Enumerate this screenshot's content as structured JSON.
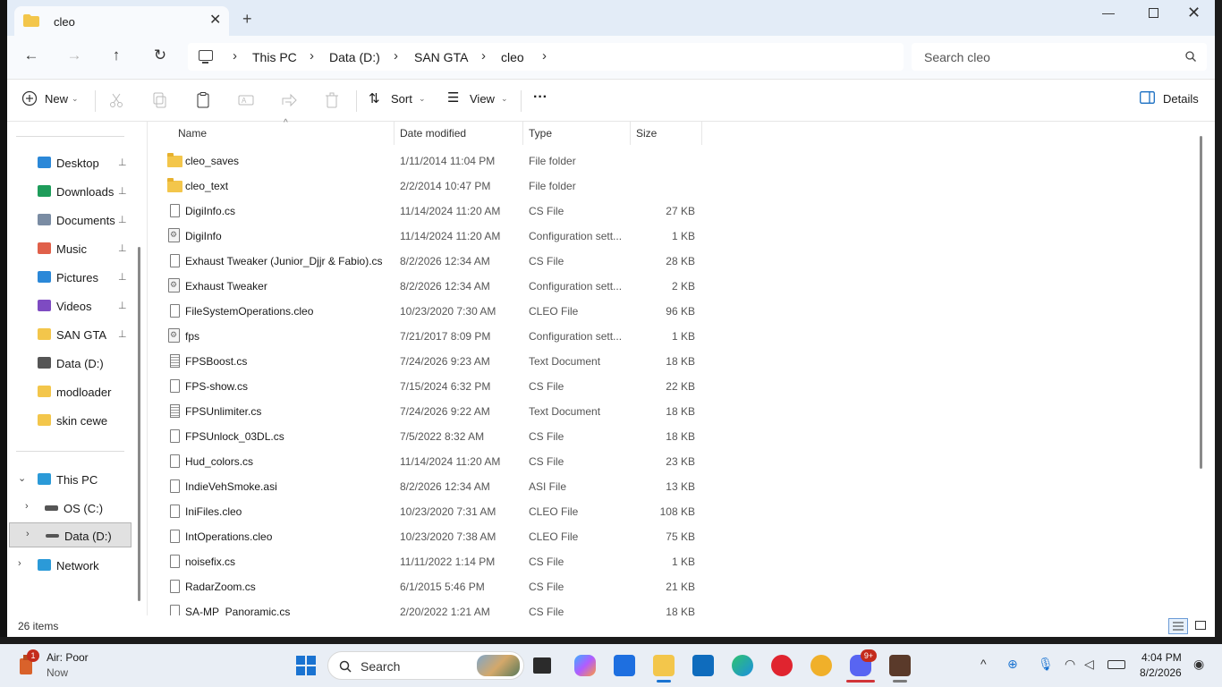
{
  "window": {
    "tab_title": "cleo",
    "new_tab": "+",
    "minimize": "—",
    "close": "✕"
  },
  "nav": {
    "back": "←",
    "forward": "→",
    "up": "↑",
    "refresh": "↻",
    "breadcrumb": [
      "This PC",
      "Data (D:)",
      "SAN GTA",
      "cleo"
    ],
    "separator": "›",
    "search_placeholder": "Search cleo"
  },
  "toolbar": {
    "new_label": "New",
    "sort_label": "Sort",
    "view_label": "View",
    "more_label": "···",
    "details_label": "Details"
  },
  "sidebar": {
    "quick_access": [
      {
        "label": "Desktop",
        "icon": "desktop-icon",
        "color": "#2b88d8"
      },
      {
        "label": "Downloads",
        "icon": "downloads-icon",
        "color": "#1e9c5a"
      },
      {
        "label": "Documents",
        "icon": "documents-icon",
        "color": "#7a8ca3"
      },
      {
        "label": "Music",
        "icon": "music-icon",
        "color": "#e0604a"
      },
      {
        "label": "Pictures",
        "icon": "pictures-icon",
        "color": "#2b88d8"
      },
      {
        "label": "Videos",
        "icon": "videos-icon",
        "color": "#7e4bc2"
      },
      {
        "label": "SAN GTA",
        "icon": "folder-icon",
        "color": "#f3c64b"
      },
      {
        "label": "Data (D:)",
        "icon": "drive-icon",
        "color": "#555555"
      },
      {
        "label": "modloader",
        "icon": "folder-icon",
        "color": "#f3c64b"
      },
      {
        "label": "skin cewe",
        "icon": "folder-icon",
        "color": "#f3c64b"
      }
    ],
    "pin": "📌",
    "this_pc": "This PC",
    "os_c": "OS (C:)",
    "data_d": "Data (D:)",
    "network": "Network"
  },
  "columns": {
    "name": "Name",
    "date": "Date modified",
    "type": "Type",
    "size": "Size"
  },
  "files": [
    {
      "name": "cleo_saves",
      "date": "1/11/2014 11:04 PM",
      "type": "File folder",
      "size": "",
      "kind": "folder"
    },
    {
      "name": "cleo_text",
      "date": "2/2/2014 10:47 PM",
      "type": "File folder",
      "size": "",
      "kind": "folder"
    },
    {
      "name": "DigiInfo.cs",
      "date": "11/14/2024 11:20 AM",
      "type": "CS File",
      "size": "27 KB",
      "kind": "file"
    },
    {
      "name": "DigiInfo",
      "date": "11/14/2024 11:20 AM",
      "type": "Configuration sett...",
      "size": "1 KB",
      "kind": "cfg"
    },
    {
      "name": "Exhaust Tweaker (Junior_Djjr & Fabio).cs",
      "date": "8/2/2026 12:34 AM",
      "type": "CS File",
      "size": "28 KB",
      "kind": "file"
    },
    {
      "name": "Exhaust Tweaker",
      "date": "8/2/2026 12:34 AM",
      "type": "Configuration sett...",
      "size": "2 KB",
      "kind": "cfg"
    },
    {
      "name": "FileSystemOperations.cleo",
      "date": "10/23/2020 7:30 AM",
      "type": "CLEO File",
      "size": "96 KB",
      "kind": "file"
    },
    {
      "name": "fps",
      "date": "7/21/2017 8:09 PM",
      "type": "Configuration sett...",
      "size": "1 KB",
      "kind": "cfg"
    },
    {
      "name": "FPSBoost.cs",
      "date": "7/24/2026 9:23 AM",
      "type": "Text Document",
      "size": "18 KB",
      "kind": "doc"
    },
    {
      "name": "FPS-show.cs",
      "date": "7/15/2024 6:32 PM",
      "type": "CS File",
      "size": "22 KB",
      "kind": "file"
    },
    {
      "name": "FPSUnlimiter.cs",
      "date": "7/24/2026 9:22 AM",
      "type": "Text Document",
      "size": "18 KB",
      "kind": "doc"
    },
    {
      "name": "FPSUnlock_03DL.cs",
      "date": "7/5/2022 8:32 AM",
      "type": "CS File",
      "size": "18 KB",
      "kind": "file"
    },
    {
      "name": "Hud_colors.cs",
      "date": "11/14/2024 11:20 AM",
      "type": "CS File",
      "size": "23 KB",
      "kind": "file"
    },
    {
      "name": "IndieVehSmoke.asi",
      "date": "8/2/2026 12:34 AM",
      "type": "ASI File",
      "size": "13 KB",
      "kind": "file"
    },
    {
      "name": "IniFiles.cleo",
      "date": "10/23/2020 7:31 AM",
      "type": "CLEO File",
      "size": "108 KB",
      "kind": "file"
    },
    {
      "name": "IntOperations.cleo",
      "date": "10/23/2020 7:38 AM",
      "type": "CLEO File",
      "size": "75 KB",
      "kind": "file"
    },
    {
      "name": "noisefix.cs",
      "date": "11/11/2022 1:14 PM",
      "type": "CS File",
      "size": "1 KB",
      "kind": "file"
    },
    {
      "name": "RadarZoom.cs",
      "date": "6/1/2015 5:46 PM",
      "type": "CS File",
      "size": "21 KB",
      "kind": "file"
    },
    {
      "name": "SA-MP_Panoramic.cs",
      "date": "2/20/2022 1:21 AM",
      "type": "CS File",
      "size": "18 KB",
      "kind": "file"
    }
  ],
  "status": {
    "item_count": "26 items"
  },
  "taskbar": {
    "weather_badge": "1",
    "weather_label": "Air: Poor",
    "weather_sub": "Now",
    "search_label": "Search",
    "discord_badge": "9+",
    "clock_time": "4:04 PM",
    "clock_date": "8/2/2026"
  }
}
